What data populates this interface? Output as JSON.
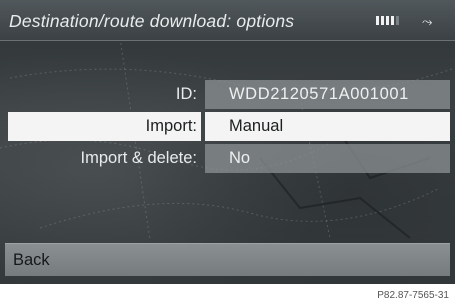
{
  "title": "Destination/route download: options",
  "status": {
    "signal_bars_active": 4,
    "signal_bars_total": 5,
    "phone_icon": "phone-connection-icon"
  },
  "fields": {
    "id": {
      "label": "ID:",
      "value": "WDD2120571A001001"
    },
    "import": {
      "label": "Import:",
      "value": "Manual",
      "selected": true
    },
    "import_delete": {
      "label": "Import & delete:",
      "value": "No"
    }
  },
  "back_label": "Back",
  "figure_ref": "P82.87-7565-31"
}
